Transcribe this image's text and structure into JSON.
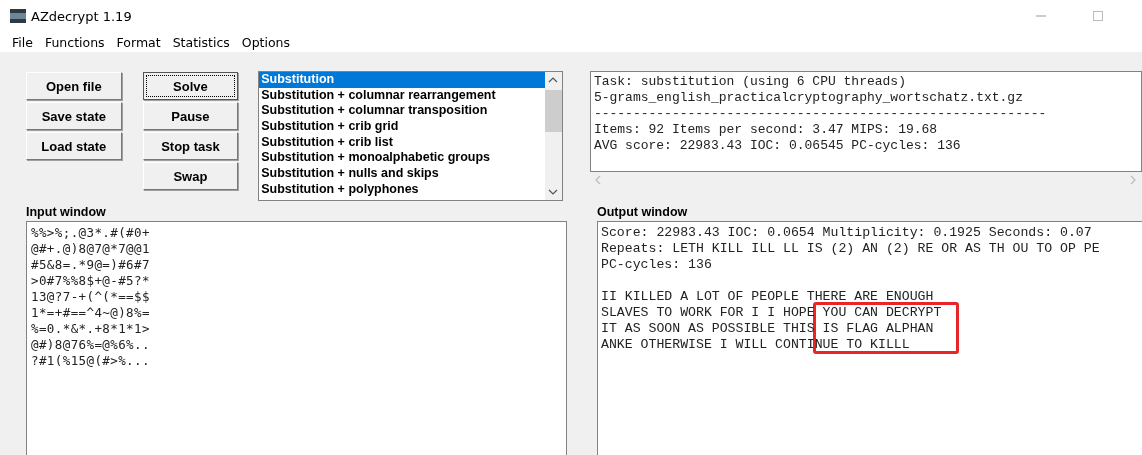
{
  "window": {
    "title": "AZdecrypt 1.19"
  },
  "menu": [
    "File",
    "Functions",
    "Format",
    "Statistics",
    "Options"
  ],
  "button_columns": [
    [
      {
        "label": "Open file",
        "focused": false
      },
      {
        "label": "Save state",
        "focused": false
      },
      {
        "label": "Load state",
        "focused": false
      }
    ],
    [
      {
        "label": "Solve",
        "focused": true
      },
      {
        "label": "Pause",
        "focused": false
      },
      {
        "label": "Stop task",
        "focused": false
      },
      {
        "label": "Swap",
        "focused": false
      }
    ]
  ],
  "tasks": [
    {
      "label": "Substitution",
      "selected": true
    },
    {
      "label": "Substitution + columnar rearrangement",
      "selected": false
    },
    {
      "label": "Substitution + columnar transposition",
      "selected": false
    },
    {
      "label": "Substitution + crib grid",
      "selected": false
    },
    {
      "label": "Substitution + crib list",
      "selected": false
    },
    {
      "label": "Substitution + monoalphabetic groups",
      "selected": false
    },
    {
      "label": "Substitution + nulls and skips",
      "selected": false
    },
    {
      "label": "Substitution + polyphones",
      "selected": false
    }
  ],
  "status_box": {
    "lines": [
      "Task: substitution (using 6 CPU threads)",
      "5-grams_english_practicalcryptography_wortschatz.txt.gz",
      "----------------------------------------------------------",
      "Items: 92 Items per second: 3.47 MIPS: 19.68",
      "AVG score: 22983.43 IOC: 0.06545 PC-cycles: 136"
    ]
  },
  "input_window": {
    "label": "Input window",
    "lines": [
      "%%>%;.@3*.#(#0+",
      "@#+.@)8@7@*7@@1",
      "#5&8=.*9@=)#6#7",
      ">0#7%%8$+@-#5?*",
      "13@?7-+(^(*==$$",
      "1*=+#==^4~@)8%=",
      "%=0.*&*.+8*1*1>",
      "@#)8@76%=@%6%..",
      "?#1(%15@(#>%..."
    ]
  },
  "output_window": {
    "label": "Output window",
    "stats_lines": [
      "Score: 22983.43 IOC: 0.0654 Multiplicity: 0.1925 Seconds: 0.07",
      "Repeats: LETH KILL ILL LL IS (2) AN (2) RE OR AS TH OU TO OP PE",
      "PC-cycles: 136"
    ],
    "text_lines": [
      "II KILLED A LOT OF PEOPLE THERE ARE ENOUGH",
      "SLAVES TO WORK FOR I I HOPE YOU CAN DECRYPT",
      "IT AS SOON AS POSSIBLE THIS IS FLAG ALPHAN",
      "ANKE OTHERWISE I WILL CONTINUE TO KILLL"
    ]
  }
}
